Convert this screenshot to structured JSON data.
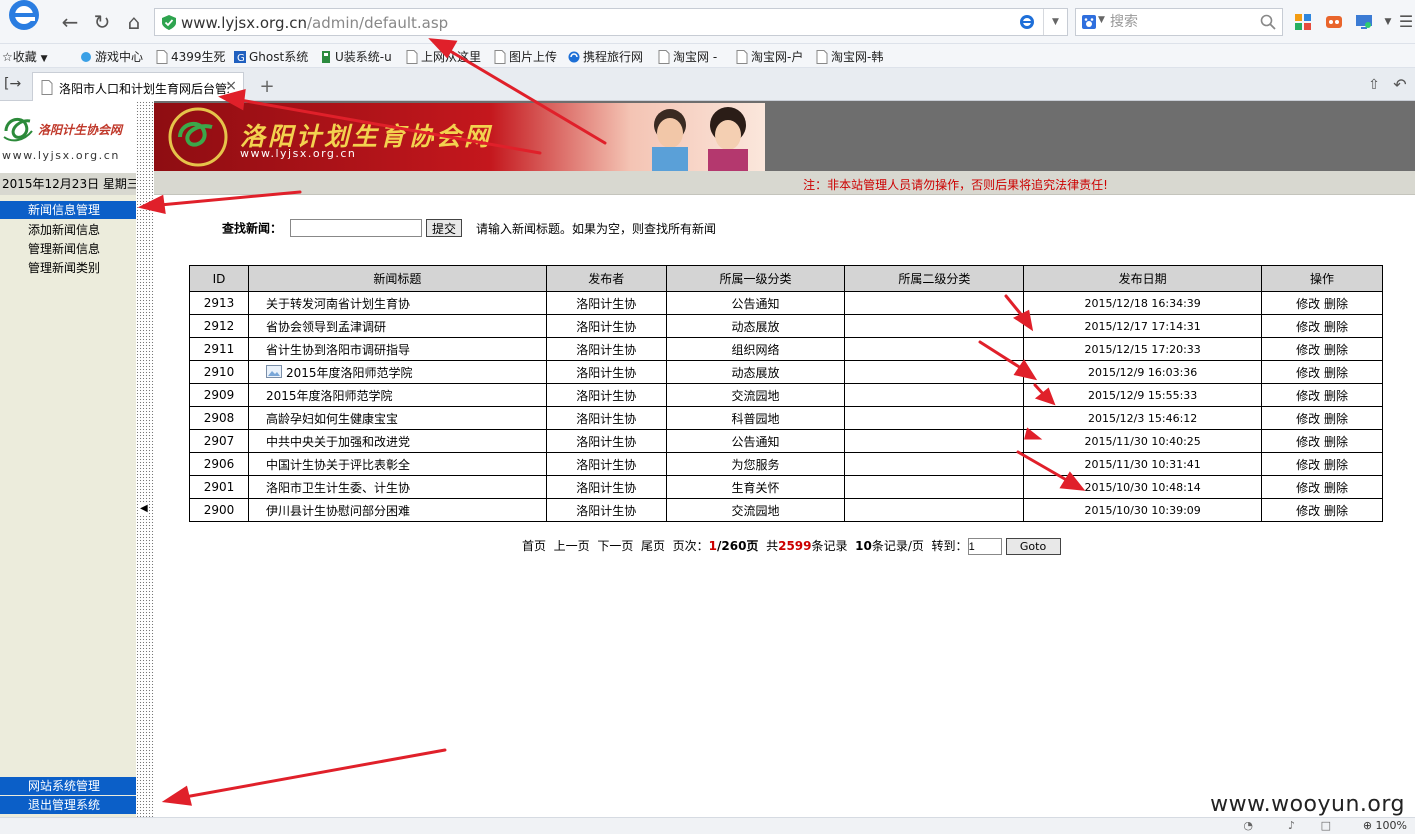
{
  "browser": {
    "url_host": "www.lyjsx.org.cn",
    "url_path": "/admin/default.asp",
    "search_placeholder": "搜索",
    "favorites": [
      {
        "label": "收藏",
        "icon": "star-icon"
      },
      {
        "label": "游戏中心",
        "icon": "game-icon"
      },
      {
        "label": "4399生死",
        "icon": "page-icon"
      },
      {
        "label": "Ghost系统",
        "icon": "ghost-icon"
      },
      {
        "label": "U装系统-u",
        "icon": "usb-icon"
      },
      {
        "label": "上网从这里",
        "icon": "page-icon"
      },
      {
        "label": "图片上传",
        "icon": "page-icon"
      },
      {
        "label": "携程旅行网",
        "icon": "ctrip-icon"
      },
      {
        "label": "淘宝网 -",
        "icon": "page-icon"
      },
      {
        "label": "淘宝网-户",
        "icon": "page-icon"
      },
      {
        "label": "淘宝网-韩",
        "icon": "page-icon"
      }
    ],
    "tab_title": "洛阳市人口和计划生育网后台管理",
    "zoom": "100%"
  },
  "site": {
    "logo_text": "洛阳计生协会网",
    "domain": "www.lyjsx.org.cn",
    "banner_title": "洛阳计划生育协会网",
    "date": "2015年12月23日 星期三",
    "notice": "注：非本站管理人员请勿操作，否则后果将追究法律责任!"
  },
  "sidebar": {
    "news_head": "新闻信息管理",
    "items": [
      "添加新闻信息",
      "管理新闻信息",
      "管理新闻类别"
    ],
    "system_head": "网站系统管理",
    "logout": "退出管理系统"
  },
  "search": {
    "label": "查找新闻：",
    "submit": "提交",
    "hint": "请输入新闻标题。如果为空，则查找所有新闻"
  },
  "table": {
    "headers": [
      "ID",
      "新闻标题",
      "发布者",
      "所属一级分类",
      "所属二级分类",
      "发布日期",
      "操作"
    ],
    "edit_label": "修改",
    "delete_label": "删除",
    "rows": [
      {
        "id": "2913",
        "title": "关于转发河南省计划生育协",
        "author": "洛阳计生协",
        "cat1": "公告通知",
        "cat2": "",
        "date": "2015/12/18 16:34:39",
        "has_image": false
      },
      {
        "id": "2912",
        "title": "省协会领导到孟津调研",
        "author": "洛阳计生协",
        "cat1": "动态展放",
        "cat2": "",
        "date": "2015/12/17 17:14:31",
        "has_image": false
      },
      {
        "id": "2911",
        "title": "省计生协到洛阳市调研指导",
        "author": "洛阳计生协",
        "cat1": "组织网络",
        "cat2": "",
        "date": "2015/12/15 17:20:33",
        "has_image": false
      },
      {
        "id": "2910",
        "title": "2015年度洛阳师范学院",
        "author": "洛阳计生协",
        "cat1": "动态展放",
        "cat2": "",
        "date": "2015/12/9 16:03:36",
        "has_image": true
      },
      {
        "id": "2909",
        "title": "2015年度洛阳师范学院",
        "author": "洛阳计生协",
        "cat1": "交流园地",
        "cat2": "",
        "date": "2015/12/9 15:55:33",
        "has_image": false
      },
      {
        "id": "2908",
        "title": "高龄孕妇如何生健康宝宝",
        "author": "洛阳计生协",
        "cat1": "科普园地",
        "cat2": "",
        "date": "2015/12/3 15:46:12",
        "has_image": false
      },
      {
        "id": "2907",
        "title": "中共中央关于加强和改进党",
        "author": "洛阳计生协",
        "cat1": "公告通知",
        "cat2": "",
        "date": "2015/11/30 10:40:25",
        "has_image": false
      },
      {
        "id": "2906",
        "title": "中国计生协关于评比表彰全",
        "author": "洛阳计生协",
        "cat1": "为您服务",
        "cat2": "",
        "date": "2015/11/30 10:31:41",
        "has_image": false
      },
      {
        "id": "2901",
        "title": "洛阳市卫生计生委、计生协",
        "author": "洛阳计生协",
        "cat1": "生育关怀",
        "cat2": "",
        "date": "2015/10/30 10:48:14",
        "has_image": false
      },
      {
        "id": "2900",
        "title": "伊川县计生协慰问部分困难",
        "author": "洛阳计生协",
        "cat1": "交流园地",
        "cat2": "",
        "date": "2015/10/30 10:39:09",
        "has_image": false
      }
    ]
  },
  "pager": {
    "first": "首页",
    "prev": "上一页",
    "next": "下一页",
    "last": "尾页",
    "page_label": "页次：",
    "page_current": "1",
    "page_total": "/260页",
    "total_prefix": "共",
    "total_count": "2599",
    "total_suffix": "条记录",
    "per_page": "10",
    "per_page_suffix": "条记录/页",
    "goto_label": "转到：",
    "goto_value": "1",
    "goto_button": "Goto"
  },
  "watermark": "www.wooyun.org",
  "colors": {
    "annotation_red": "#e0202a",
    "menu_blue": "#0b5fc8",
    "notice_red": "#cc0000"
  }
}
